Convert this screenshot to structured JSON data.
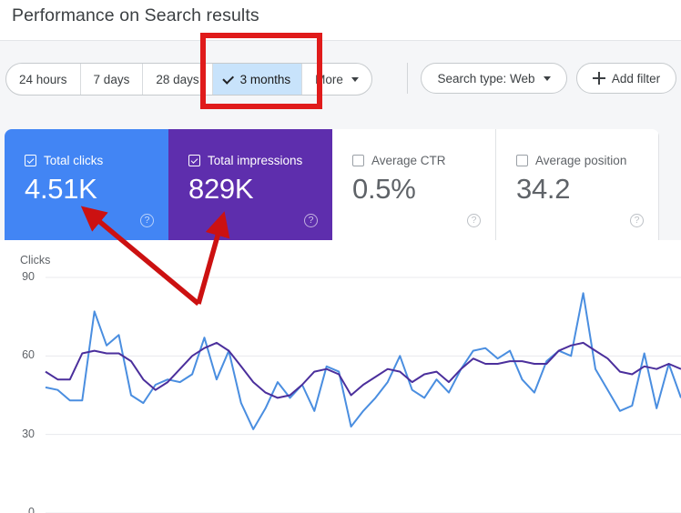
{
  "header": {
    "title": "Performance on Search results"
  },
  "toolbar": {
    "date_range_segments": [
      {
        "label": "24 hours",
        "selected": false
      },
      {
        "label": "7 days",
        "selected": false
      },
      {
        "label": "28 days",
        "selected": false
      },
      {
        "label": "3 months",
        "selected": true
      },
      {
        "label": "More",
        "selected": false
      }
    ],
    "search_type_label": "Search type: Web",
    "add_filter_label": "Add filter",
    "check_icon": "check-icon",
    "caret_icon": "chevron-down-icon",
    "plus_icon": "plus-icon"
  },
  "metric_cards": [
    {
      "label": "Total clicks",
      "value": "4.51K",
      "checked": true,
      "color": "#4285f4",
      "help": "?"
    },
    {
      "label": "Total impressions",
      "value": "829K",
      "checked": true,
      "color": "#5e2ead",
      "help": "?"
    },
    {
      "label": "Average CTR",
      "value": "0.5%",
      "checked": false,
      "color": "#ffffff",
      "help": "?"
    },
    {
      "label": "Average position",
      "value": "34.2",
      "checked": false,
      "color": "#ffffff",
      "help": "?"
    }
  ],
  "annotations": {
    "highlight_box_target": "3 months",
    "arrow_color": "#cc1111",
    "box_color": "#e01b1b",
    "arrow_targets": [
      "Total clicks",
      "Total impressions"
    ]
  },
  "chart_data": {
    "type": "line",
    "title": "",
    "xlabel": "",
    "ylabel": "Clicks",
    "ylim": [
      0,
      90
    ],
    "yticks": [
      90,
      60,
      30,
      0
    ],
    "ytick_labels": [
      "90",
      "60",
      "30",
      "0"
    ],
    "grid": true,
    "legend": "none",
    "x": [
      0,
      1,
      2,
      3,
      4,
      5,
      6,
      7,
      8,
      9,
      10,
      11,
      12,
      13,
      14,
      15,
      16,
      17,
      18,
      19,
      20,
      21,
      22,
      23,
      24,
      25,
      26,
      27,
      28,
      29,
      30,
      31,
      32,
      33,
      34,
      35,
      36,
      37,
      38,
      39,
      40,
      41,
      42,
      43,
      44,
      45,
      46,
      47,
      48,
      49,
      50,
      51,
      52
    ],
    "series": [
      {
        "name": "Total clicks",
        "color": "#4a8ee0",
        "values": [
          48,
          47,
          43,
          43,
          77,
          64,
          68,
          45,
          42,
          49,
          51,
          50,
          53,
          67,
          51,
          62,
          42,
          32,
          40,
          50,
          44,
          49,
          39,
          56,
          54,
          33,
          39,
          44,
          50,
          60,
          47,
          44,
          51,
          46,
          55,
          62,
          63,
          59,
          62,
          51,
          46,
          58,
          62,
          60,
          84,
          55,
          47,
          39,
          41,
          61,
          40,
          57,
          44
        ]
      },
      {
        "name": "Total impressions",
        "color": "#4b2f9c",
        "values": [
          54,
          51,
          51,
          61,
          62,
          61,
          61,
          58,
          51,
          47,
          50,
          55,
          60,
          63,
          65,
          62,
          56,
          50,
          46,
          44,
          45,
          49,
          54,
          55,
          53,
          45,
          49,
          52,
          55,
          54,
          50,
          53,
          54,
          50,
          55,
          59,
          57,
          57,
          58,
          58,
          57,
          57,
          62,
          64,
          65,
          62,
          59,
          54,
          53,
          56,
          55,
          57,
          55
        ]
      }
    ]
  }
}
